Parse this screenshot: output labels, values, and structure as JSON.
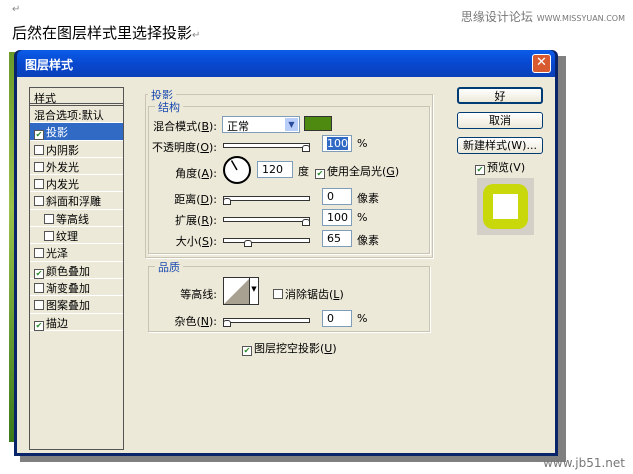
{
  "doc": {
    "para_mark": "↵",
    "heading": "后然在图层样式里选择投影",
    "watermark_top": "思缘设计论坛",
    "watermark_top_url": "WWW.MISSYUAN.COM",
    "watermark_bottom": "www.jb51.net"
  },
  "dialog": {
    "title": "图层样式",
    "close": "✕"
  },
  "styles": {
    "header": "样式",
    "items": [
      {
        "label": "混合选项:默认",
        "checkbox": false,
        "checked": false,
        "selected": false,
        "indent": false
      },
      {
        "label": "投影",
        "checkbox": true,
        "checked": true,
        "selected": true,
        "indent": false
      },
      {
        "label": "内阴影",
        "checkbox": true,
        "checked": false,
        "selected": false,
        "indent": false
      },
      {
        "label": "外发光",
        "checkbox": true,
        "checked": false,
        "selected": false,
        "indent": false
      },
      {
        "label": "内发光",
        "checkbox": true,
        "checked": false,
        "selected": false,
        "indent": false
      },
      {
        "label": "斜面和浮雕",
        "checkbox": true,
        "checked": false,
        "selected": false,
        "indent": false
      },
      {
        "label": "等高线",
        "checkbox": true,
        "checked": false,
        "selected": false,
        "indent": true
      },
      {
        "label": "纹理",
        "checkbox": true,
        "checked": false,
        "selected": false,
        "indent": true
      },
      {
        "label": "光泽",
        "checkbox": true,
        "checked": false,
        "selected": false,
        "indent": false
      },
      {
        "label": "颜色叠加",
        "checkbox": true,
        "checked": true,
        "selected": false,
        "indent": false
      },
      {
        "label": "渐变叠加",
        "checkbox": true,
        "checked": false,
        "selected": false,
        "indent": false
      },
      {
        "label": "图案叠加",
        "checkbox": true,
        "checked": false,
        "selected": false,
        "indent": false
      },
      {
        "label": "描边",
        "checkbox": true,
        "checked": true,
        "selected": false,
        "indent": false
      }
    ]
  },
  "shadow": {
    "title": "投影",
    "structure": "结构",
    "blend_label": "混合模式(",
    "blend_key": "B",
    "blend_end": "):",
    "blend_value": "正常",
    "shadow_color": "#4f8a10",
    "opacity_label": "不透明度(",
    "opacity_key": "O",
    "opacity_end": "):",
    "opacity_value": "100",
    "opacity_unit": "%",
    "opacity_pct": 100,
    "angle_label": "角度(",
    "angle_key": "A",
    "angle_end": "):",
    "angle_value": "120",
    "angle_unit": "度",
    "angle_deg": 120,
    "global_light": "使用全局光(",
    "global_light_key": "G",
    "global_light_end": ")",
    "global_light_checked": true,
    "distance_label": "距离(",
    "distance_key": "D",
    "distance_end": "):",
    "distance_value": "0",
    "distance_unit": "像素",
    "distance_pct": 0,
    "spread_label": "扩展(",
    "spread_key": "R",
    "spread_end": "):",
    "spread_value": "100",
    "spread_unit": "%",
    "spread_pct": 100,
    "size_label": "大小(",
    "size_key": "S",
    "size_end": "):",
    "size_value": "65",
    "size_unit": "像素",
    "size_pct": 26
  },
  "quality": {
    "title": "品质",
    "contour_label": "等高线:",
    "antialias": "消除锯齿(",
    "antialias_key": "L",
    "antialias_end": ")",
    "antialias_checked": false,
    "noise_label": "杂色(",
    "noise_key": "N",
    "noise_end": "):",
    "noise_value": "0",
    "noise_unit": "%",
    "noise_pct": 0,
    "knockout": "图层挖空投影(",
    "knockout_key": "U",
    "knockout_end": ")",
    "knockout_checked": true
  },
  "buttons": {
    "ok": "好",
    "cancel": "取消",
    "new_style": "新建样式(W)...",
    "preview": "预览(V)",
    "preview_checked": true
  },
  "colors": {
    "preview_ring": "#c8d80a",
    "title_bar": "#0a5ce8",
    "selected": "#316ac5"
  }
}
